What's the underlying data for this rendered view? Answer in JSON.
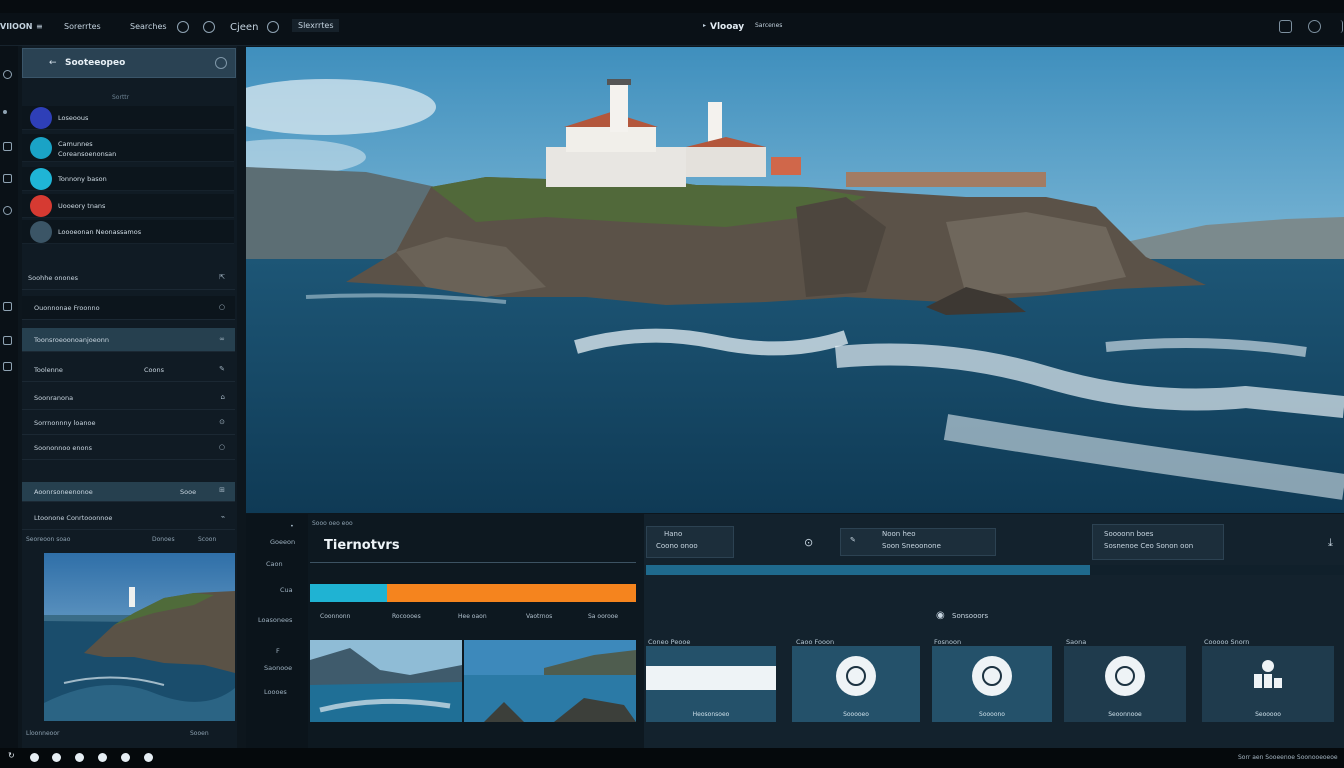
{
  "topbar": {
    "logo": "VIIOON",
    "item1": "Sorerrtes",
    "item2": "Searches",
    "item3": "Cjeen",
    "item4": "Slexrrtes",
    "title": "Vlooay",
    "title_sub": "Sarcenes"
  },
  "sidebar": {
    "header_title": "Sooteeopeo",
    "sub_label": "Sorttr",
    "contacts": [
      {
        "label": "Loseoous",
        "color": "#2e3fb8"
      },
      {
        "label": "Camunnes",
        "label2": "Coreansoenonsan",
        "color": "#1aa3c6"
      },
      {
        "label": "Tonnony bason",
        "color": "#1fb5d6"
      },
      {
        "label": "Uooeory tnans",
        "color": "#d63a32"
      },
      {
        "label": "Loooeonan Neonassamos",
        "color": "#3b5566"
      }
    ],
    "rows": [
      {
        "label": "Soohhe onones",
        "ind": "⇱"
      },
      {
        "label": "Ouonnonae Froonno",
        "ind": "○"
      },
      {
        "label": "Toonsroeoonoanjoeonn",
        "ind": "∞"
      },
      {
        "label": "Toolenne",
        "mid": "Coons",
        "ind": "✎"
      },
      {
        "label": "Soonranona",
        "ind": "⌂"
      },
      {
        "label": "Sorrnonnny loanoe",
        "ind": "⊙"
      },
      {
        "label": "Soononnoo enons",
        "ind": "○"
      },
      {
        "label": "Aoonrsoneenonoe",
        "mid": "Sooe",
        "ind": "⊞"
      },
      {
        "label": "Ltoonone Conrtooonnoe",
        "ind": "⌁"
      }
    ],
    "caption_left": "Seoreoon soao",
    "caption_mid": "Donoes",
    "caption_right": "Scoon",
    "footer_left": "Lloonneoor",
    "footer_right": "Sooen"
  },
  "bottom_nav": [
    "Goeeon",
    "Caon",
    "Cua",
    "Loasonees",
    "F",
    "Saonooe",
    "Loooes"
  ],
  "center": {
    "small_label": "Sooo oeo eoo",
    "big_label": "Tiernotvrs",
    "bar_labels": [
      "Coonnonn",
      "Rocoooes",
      "Hee oaon",
      "Vaotrnos",
      "Sa oorooe"
    ]
  },
  "right": {
    "box1_l1": "Hano",
    "box1_l2": "Coono onoo",
    "box2_l1": "Noon heo",
    "box2_l2": "Soon Sneoonone",
    "box3_l1": "Soooonn boes",
    "box3_l2": "Sosnenoe Ceo Sonon oon",
    "mid_label": "Sonsooors",
    "cards": [
      {
        "title": "Coneo Peooe",
        "label": "Heosonsoeo"
      },
      {
        "title": "Caoo Fooon",
        "label": "Sooooeo"
      },
      {
        "title": "Fosnoon",
        "label": "Soooono"
      },
      {
        "title": "Saona",
        "label": "Seoonnooe"
      },
      {
        "title": "Cooooo Snorn",
        "label": "Seooooo"
      }
    ]
  },
  "status": {
    "right_text": "Sorr aen  Sooeenoe Soonooeoeoe"
  }
}
